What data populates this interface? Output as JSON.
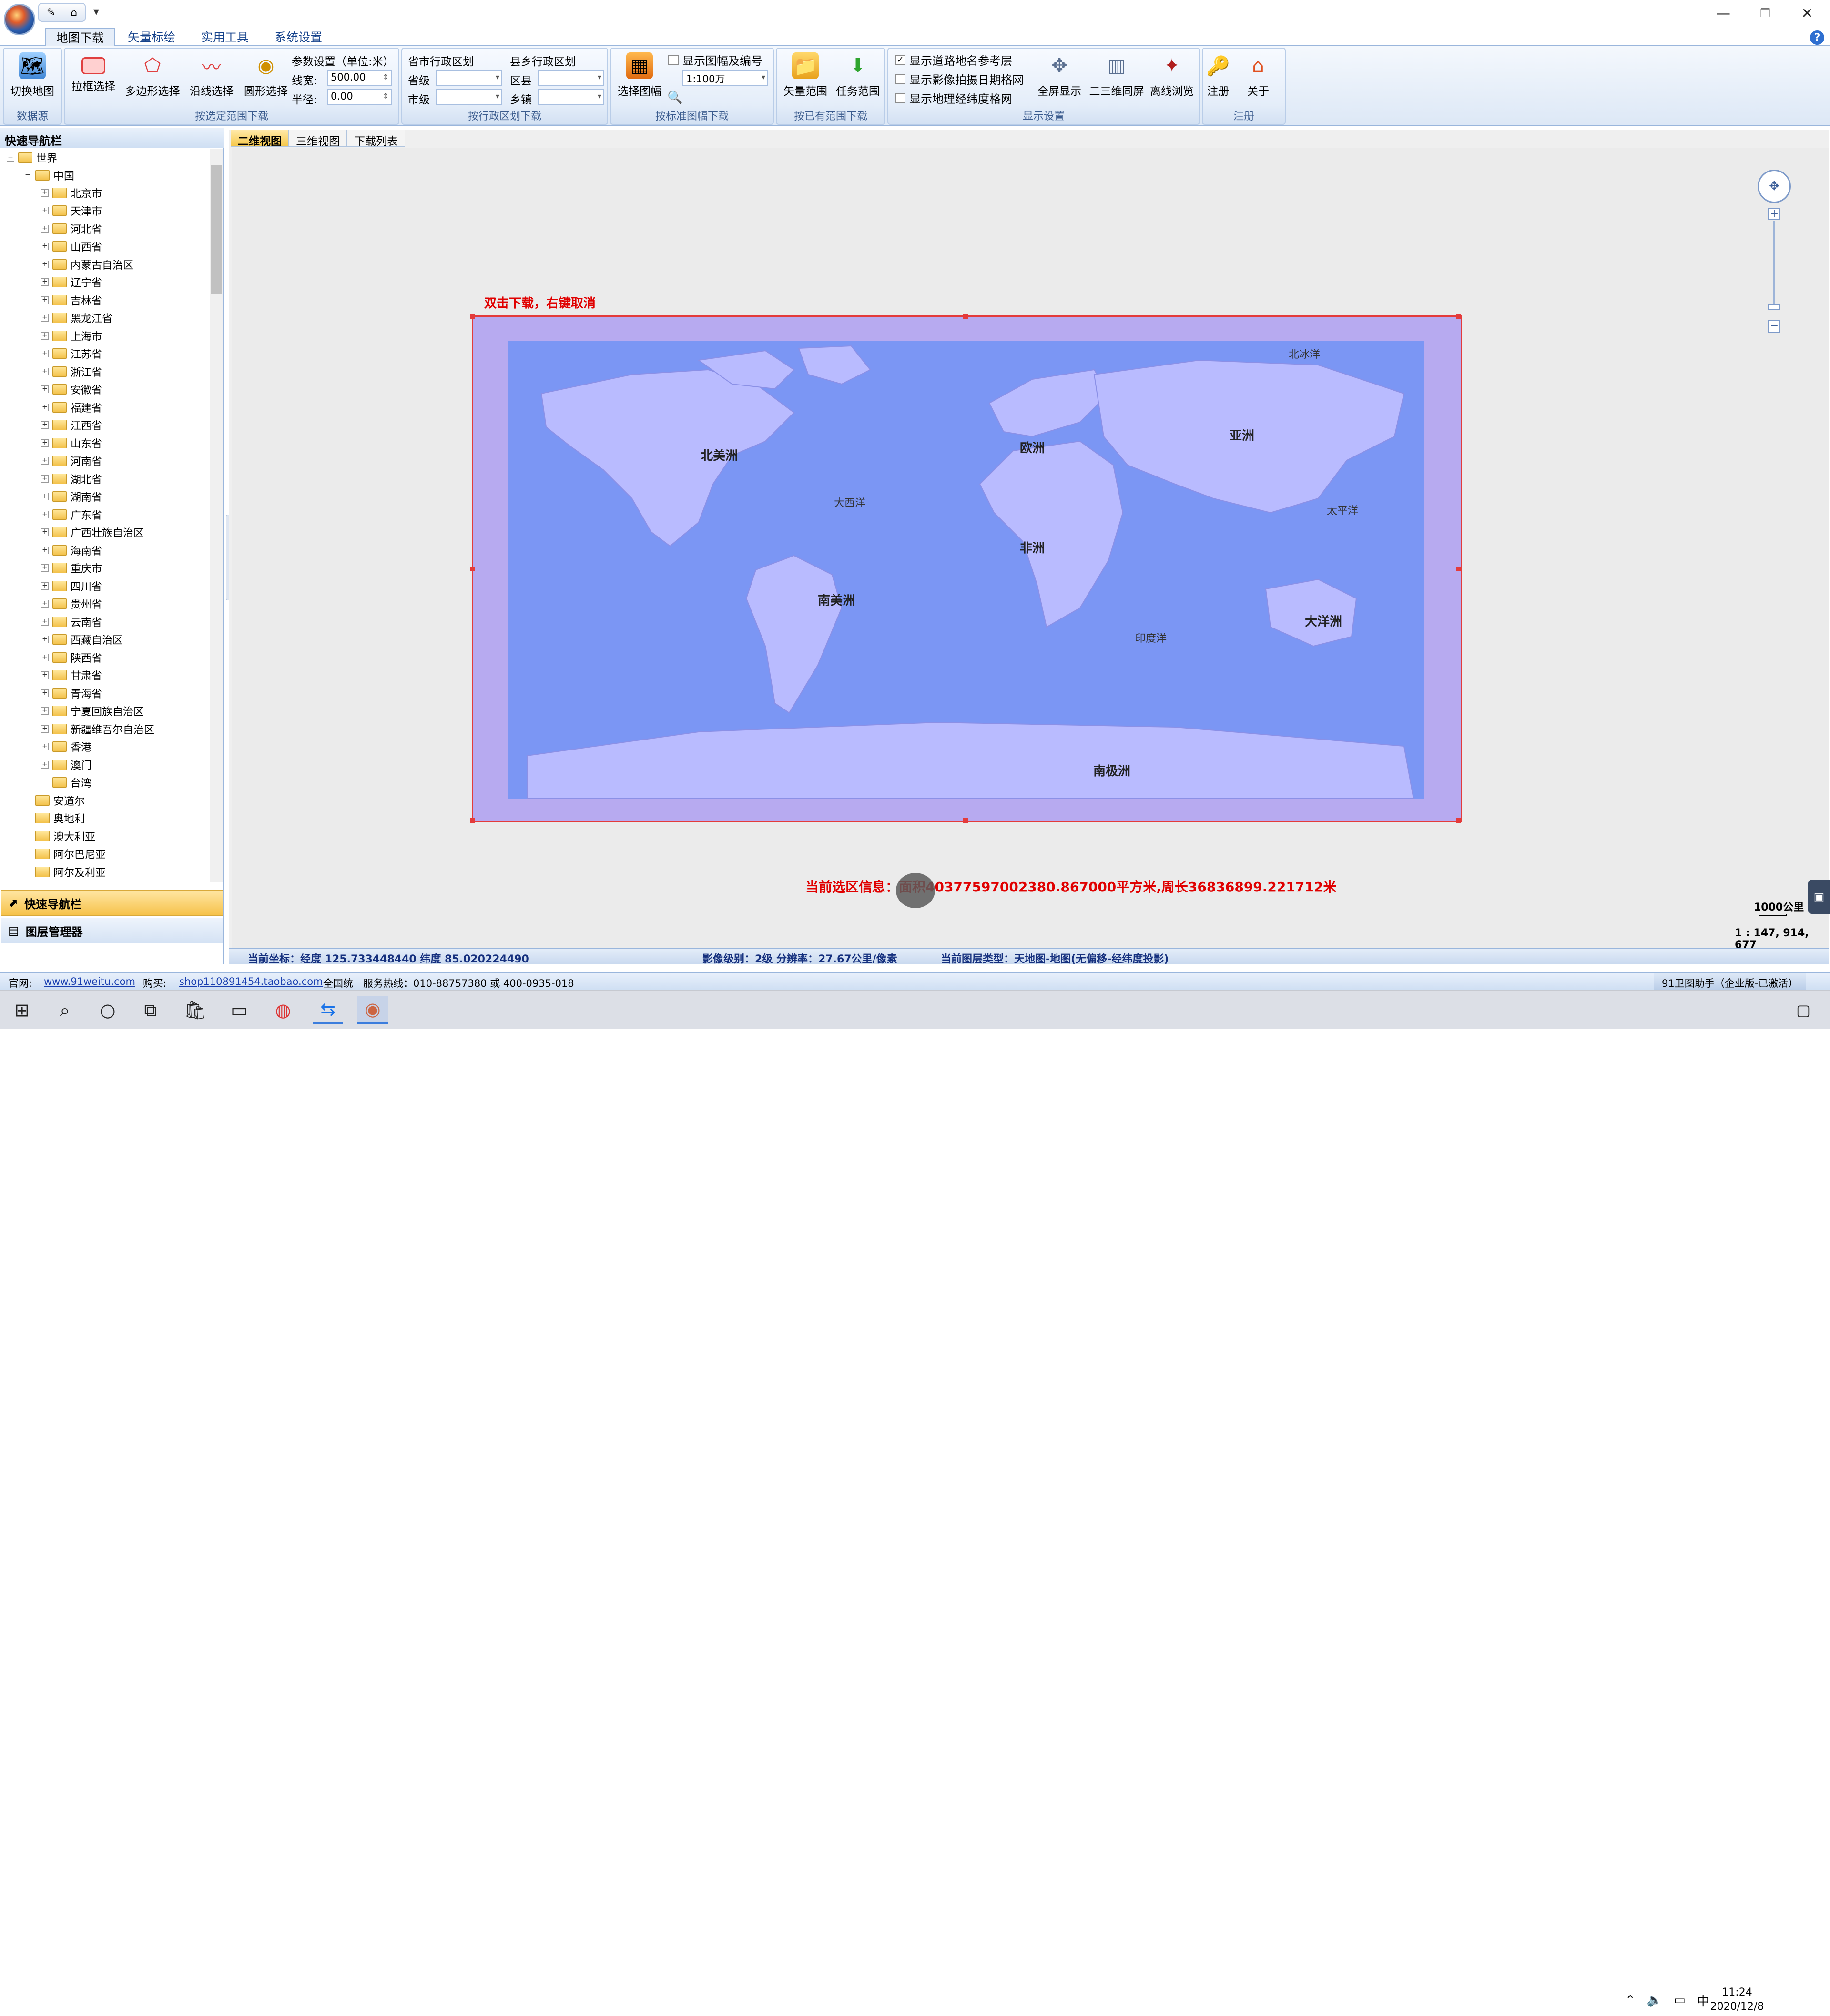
{
  "window": {
    "minimize": "—",
    "restore": "❐",
    "close": "✕",
    "help": "?"
  },
  "qat": {
    "drop": "▾"
  },
  "ribbon_tabs": [
    "地图下载",
    "矢量标绘",
    "实用工具",
    "系统设置"
  ],
  "groups": {
    "datasource": {
      "label": "数据源",
      "buttons": [
        "切换地图"
      ]
    },
    "range_select": {
      "label": "按选定范围下载",
      "buttons": [
        "拉框选择",
        "多边形选择",
        "沿线选择",
        "圆形选择"
      ],
      "params_title": "参数设置（单位:米）",
      "width_label": "线宽:",
      "width_value": "500.00",
      "radius_label": "半径:",
      "radius_value": "0.00"
    },
    "admin": {
      "label": "按行政区划下载",
      "province_title": "省市行政区划",
      "county_title": "县乡行政区划",
      "province": "省级",
      "city": "市级",
      "district": "区县",
      "town": "乡镇"
    },
    "sheet": {
      "label": "按标准图幅下载",
      "button": "选择图幅",
      "show_sheet": "显示图幅及编号",
      "scale": "1:100万"
    },
    "existing": {
      "label": "按已有范围下载",
      "buttons": [
        "矢量范围",
        "任务范围"
      ]
    },
    "display": {
      "label": "显示设置",
      "chk_road": "显示道路地名参考层",
      "chk_date": "显示影像拍摄日期格网",
      "chk_grid": "显示地理经纬度格网",
      "buttons": [
        "全屏显示",
        "二三维同屏",
        "离线浏览"
      ]
    },
    "register": {
      "label": "注册",
      "buttons": [
        "注册",
        "关于"
      ]
    }
  },
  "sidebar": {
    "title": "快速导航栏",
    "root": "世界",
    "china": "中国",
    "provinces": [
      "北京市",
      "天津市",
      "河北省",
      "山西省",
      "内蒙古自治区",
      "辽宁省",
      "吉林省",
      "黑龙江省",
      "上海市",
      "江苏省",
      "浙江省",
      "安徽省",
      "福建省",
      "江西省",
      "山东省",
      "河南省",
      "湖北省",
      "湖南省",
      "广东省",
      "广西壮族自治区",
      "海南省",
      "重庆市",
      "四川省",
      "贵州省",
      "云南省",
      "西藏自治区",
      "陕西省",
      "甘肃省",
      "青海省",
      "宁夏回族自治区",
      "新疆维吾尔自治区",
      "香港",
      "澳门",
      "台湾"
    ],
    "countries": [
      "安道尔",
      "奥地利",
      "澳大利亚",
      "阿尔巴尼亚",
      "阿尔及利亚"
    ],
    "nav_quick": "快速导航栏",
    "nav_layers": "图层管理器"
  },
  "view_tabs": [
    "二维视图",
    "三维视图",
    "下载列表"
  ],
  "map": {
    "hint": "双击下载，右键取消",
    "continents": {
      "na": "北美洲",
      "eu": "欧洲",
      "as": "亚洲",
      "af": "非洲",
      "sa": "南美洲",
      "oc": "大洋洲",
      "an": "南极洲"
    },
    "oceans": {
      "arctic": "北冰洋",
      "atlantic": "大西洋",
      "pacific": "太平洋",
      "indian": "印度洋"
    },
    "selection_info": "当前选区信息：面积40377597002380.867000平方米,周长36836899.221712米",
    "scale_text": "1000公里",
    "scale_ratio": "1 : 147, 914, 677"
  },
  "status": {
    "coords": "当前坐标：经度 125.733448440 纬度 85.020224490",
    "level": "影像级别：2级 分辨率：27.67公里/像素",
    "layer": "当前图层类型：天地图-地图(无偏移-经纬度投影)"
  },
  "footer": {
    "site_label": "官网:",
    "site": "www.91weitu.com",
    "buy_label": "购买:",
    "shop": "shop110891454.taobao.com",
    "hotline": "全国统一服务热线：010-88757380 或 400-0935-018",
    "edition": "91卫图助手（企业版-已激活）"
  },
  "taskbar": {
    "ime": "中",
    "time": "11:24",
    "date": "2020/12/8"
  }
}
